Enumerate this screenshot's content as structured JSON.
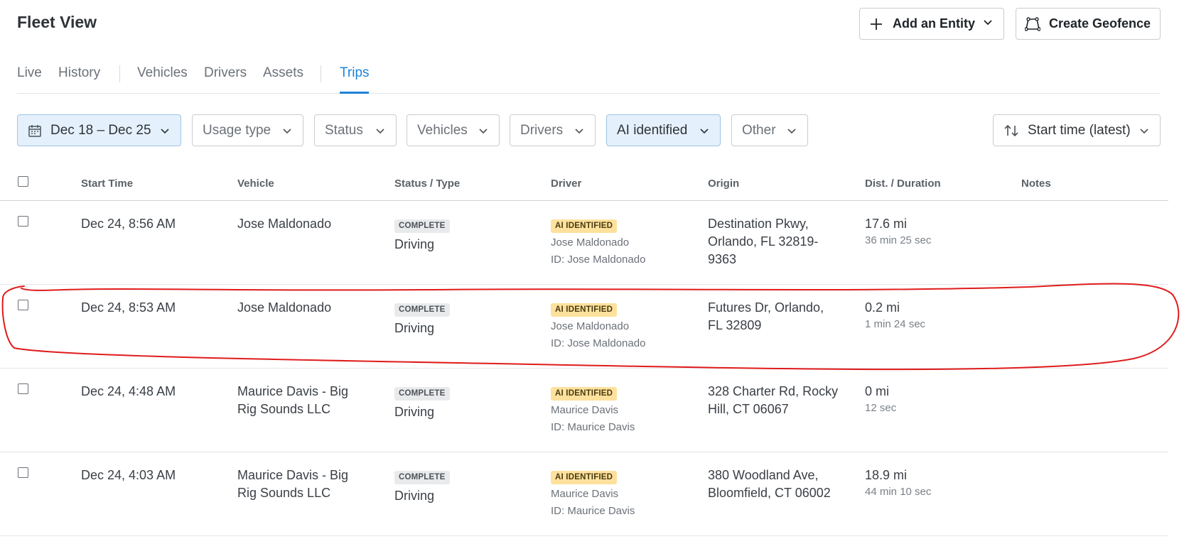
{
  "header": {
    "title": "Fleet View"
  },
  "actions": {
    "add_entity": "Add an Entity",
    "create_geofence": "Create Geofence"
  },
  "tabs": [
    {
      "label": "Live"
    },
    {
      "label": "History"
    },
    {
      "label": "Vehicles"
    },
    {
      "label": "Drivers"
    },
    {
      "label": "Assets"
    },
    {
      "label": "Trips"
    }
  ],
  "active_tab": "Trips",
  "filters": {
    "date": "Dec 18 – Dec 25",
    "usage_type": "Usage type",
    "status": "Status",
    "vehicles": "Vehicles",
    "drivers": "Drivers",
    "ai_identified": "AI identified",
    "other": "Other",
    "sort": "Start time (latest)"
  },
  "columns": [
    "Start Time",
    "Vehicle",
    "Status / Type",
    "Driver",
    "Origin",
    "Dist. / Duration",
    "Notes"
  ],
  "rows": [
    {
      "start_time": "Dec 24, 8:56 AM",
      "vehicle": "Jose Maldonado",
      "status": "COMPLETE",
      "type": "Driving",
      "driver_badge": "AI IDENTIFIED",
      "driver_name": "Jose Maldonado",
      "driver_id": "ID: Jose Maldonado",
      "origin": "Destination Pkwy, Orlando, FL 32819-9363",
      "distance": "17.6 mi",
      "duration": "36 min 25 sec"
    },
    {
      "start_time": "Dec 24, 8:53 AM",
      "vehicle": "Jose Maldonado",
      "status": "COMPLETE",
      "type": "Driving",
      "driver_badge": "AI IDENTIFIED",
      "driver_name": "Jose Maldonado",
      "driver_id": "ID: Jose Maldonado",
      "origin": "Futures Dr, Orlando, FL 32809",
      "distance": "0.2 mi",
      "duration": "1 min 24 sec"
    },
    {
      "start_time": "Dec 24, 4:48 AM",
      "vehicle": "Maurice Davis - Big Rig Sounds LLC",
      "status": "COMPLETE",
      "type": "Driving",
      "driver_badge": "AI IDENTIFIED",
      "driver_name": "Maurice Davis",
      "driver_id": "ID: Maurice Davis",
      "origin": "328 Charter Rd, Rocky Hill, CT 06067",
      "distance": "0 mi",
      "duration": "12 sec"
    },
    {
      "start_time": "Dec 24, 4:03 AM",
      "vehicle": "Maurice Davis - Big Rig Sounds LLC",
      "status": "COMPLETE",
      "type": "Driving",
      "driver_badge": "AI IDENTIFIED",
      "driver_name": "Maurice Davis",
      "driver_id": "ID: Maurice Davis",
      "origin": "380 Woodland Ave, Bloomfield, CT 06002",
      "distance": "18.9 mi",
      "duration": "44 min 10 sec"
    }
  ],
  "colors": {
    "accent": "#1f82d8",
    "ai_badge": "#fde19c",
    "annotation": "#e01b1b"
  }
}
